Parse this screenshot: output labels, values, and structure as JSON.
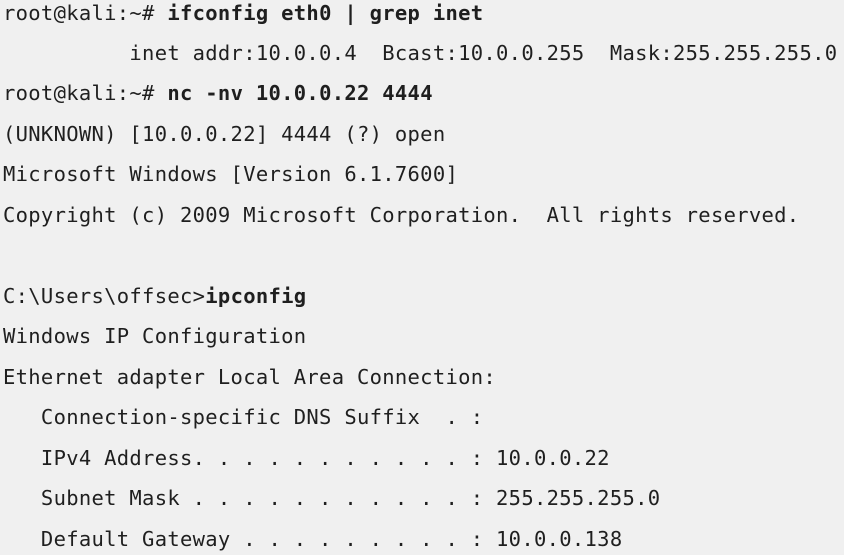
{
  "lines": [
    {
      "text": "root@kali:~# ",
      "command": "ifconfig eth0 | grep inet"
    },
    {
      "text": "          inet addr:10.0.0.4  Bcast:10.0.0.255  Mask:255.255.255.0",
      "command": ""
    },
    {
      "text": "root@kali:~# ",
      "command": "nc -nv 10.0.0.22 4444"
    },
    {
      "text": "(UNKNOWN) [10.0.0.22] 4444 (?) open",
      "command": ""
    },
    {
      "text": "Microsoft Windows [Version 6.1.7600]",
      "command": ""
    },
    {
      "text": "Copyright (c) 2009 Microsoft Corporation.  All rights reserved.",
      "command": ""
    },
    {
      "text": "C:\\Users\\offsec>",
      "command": "ipconfig"
    },
    {
      "text": "Windows IP Configuration",
      "command": ""
    },
    {
      "text": "Ethernet adapter Local Area Connection:",
      "command": ""
    },
    {
      "text": "   Connection-specific DNS Suffix  . :",
      "command": ""
    },
    {
      "text": "   IPv4 Address. . . . . . . . . . . : 10.0.0.22",
      "command": ""
    },
    {
      "text": "   Subnet Mask . . . . . . . . . . . : 255.255.255.0",
      "command": ""
    },
    {
      "text": "   Default Gateway . . . . . . . . . : 10.0.0.138",
      "command": ""
    }
  ]
}
